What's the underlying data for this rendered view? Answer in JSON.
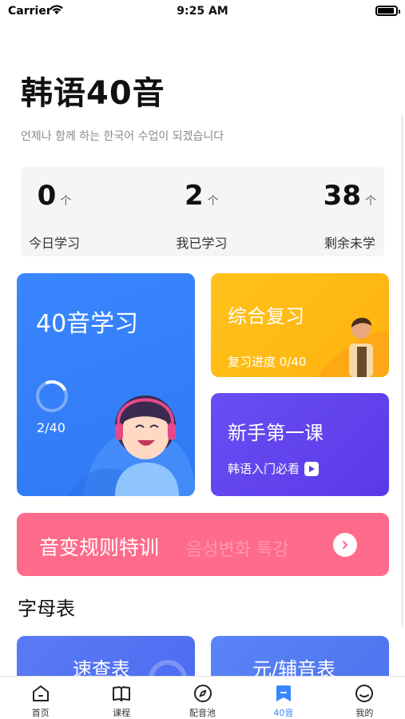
{
  "status_bar": {
    "carrier": "Carrier",
    "time": "9:25 AM"
  },
  "header": {
    "title": "韩语40音",
    "subtitle": "언제나 함께  하는 한국어 수업이 되겠습니다"
  },
  "stats": [
    {
      "value": "0",
      "unit": "个",
      "label": "今日学习"
    },
    {
      "value": "2",
      "unit": "个",
      "label": "我已学习"
    },
    {
      "value": "38",
      "unit": "个",
      "label": "剩余未学"
    }
  ],
  "cards": {
    "learn": {
      "title": "40音学习",
      "progress": "2/40",
      "progress_fraction": 0.05
    },
    "review": {
      "title": "综合复习",
      "subtitle": "复习进度 0/40"
    },
    "lesson": {
      "title": "新手第一课",
      "subtitle": "韩语入门必看"
    },
    "banner": {
      "title": "音变规则特训",
      "ghost_text": "음성변화 특강"
    }
  },
  "alphabet": {
    "section_title": "字母表",
    "cards": [
      {
        "title": "速查表"
      },
      {
        "title": "元/辅音表"
      }
    ]
  },
  "tabbar": {
    "active": "40音",
    "tabs": [
      {
        "label": "首页",
        "icon": "home-icon"
      },
      {
        "label": "课程",
        "icon": "book-icon"
      },
      {
        "label": "配音池",
        "icon": "compass-icon"
      },
      {
        "label": "40音",
        "icon": "bookmark-icon"
      },
      {
        "label": "我的",
        "icon": "profile-icon"
      }
    ]
  },
  "colors": {
    "learn_card": "#3a86ff",
    "review_card": "#ffb30f",
    "lesson_card": "#5a3ae8",
    "banner_card": "#ff6b8a",
    "active_tab": "#3a86ff"
  }
}
